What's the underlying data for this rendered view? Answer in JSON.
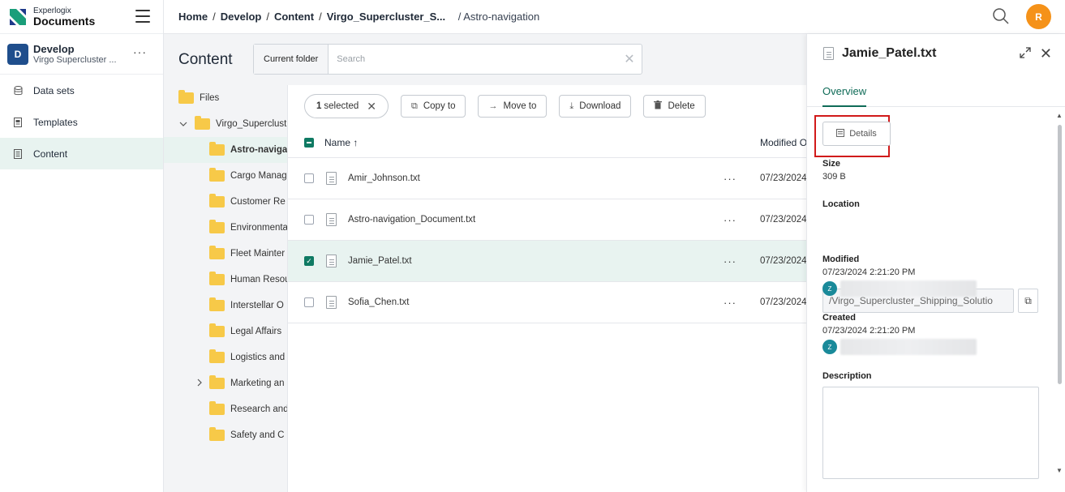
{
  "brand": {
    "small": "Experlogix",
    "big": "Documents"
  },
  "workspace": {
    "initial": "D",
    "name": "Develop",
    "sub": "Virgo Supercluster ..."
  },
  "nav": [
    {
      "label": "Data sets",
      "icon": "database-icon"
    },
    {
      "label": "Templates",
      "icon": "template-icon"
    },
    {
      "label": "Content",
      "icon": "content-icon",
      "active": true
    }
  ],
  "breadcrumb": {
    "home": "Home",
    "develop": "Develop",
    "content": "Content",
    "folder": "Virgo_Supercluster_S...",
    "current": "/ Astro-navigation"
  },
  "user": {
    "initial": "R"
  },
  "page_title": "Content",
  "search": {
    "scope_label": "Current folder",
    "placeholder": "Search"
  },
  "tree": {
    "root": "Files",
    "parent": "Virgo_Superclust",
    "folders": [
      "Astro-naviga",
      "Cargo Manag",
      "Customer Re",
      "Environmenta",
      "Fleet Mainter",
      "Human Resou",
      "Interstellar O",
      "Legal Affairs",
      "Logistics and",
      "Marketing an",
      "Research and",
      "Safety and C"
    ]
  },
  "toolbar": {
    "selected_count": "1",
    "selected_label": "selected",
    "copy": "Copy to",
    "move": "Move to",
    "download": "Download",
    "delete": "Delete"
  },
  "list": {
    "col_name": "Name ↑",
    "col_modified": "Modified O",
    "rows": [
      {
        "name": "Amir_Johnson.txt",
        "date": "07/23/2024",
        "selected": false
      },
      {
        "name": "Astro-navigation_Document.txt",
        "date": "07/23/2024",
        "selected": false
      },
      {
        "name": "Jamie_Patel.txt",
        "date": "07/23/2024",
        "selected": true
      },
      {
        "name": "Sofia_Chen.txt",
        "date": "07/23/2024",
        "selected": false
      }
    ]
  },
  "panel": {
    "title": "Jamie_Patel.txt",
    "tab": "Overview",
    "details_btn": "Details",
    "size_label": "Size",
    "size_value": "309 B",
    "location_label": "Location",
    "location_value": "/Virgo_Supercluster_Shipping_Solutio",
    "modified_label": "Modified",
    "modified_value": "07/23/2024 2:21:20 PM",
    "created_label": "Created",
    "created_value": "07/23/2024 2:21:20 PM",
    "user_initial": "Z",
    "description_label": "Description"
  },
  "colors": {
    "accent": "#0f7a63",
    "avatar": "#f59219",
    "workspace": "#1f4e8c",
    "highlight_box": "#d11a1a"
  }
}
